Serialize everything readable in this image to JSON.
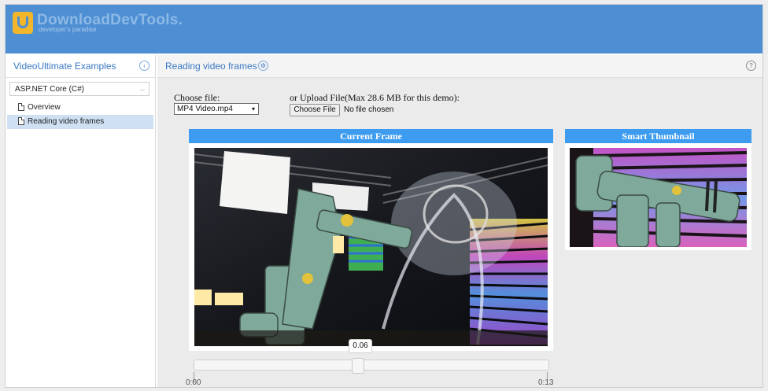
{
  "brand": {
    "title": "DownloadDevTools.",
    "subtitle": "developer's paradise"
  },
  "sidebar": {
    "title": "VideoUltimate Examples",
    "collapse_icon": "chevron-left-circle-icon",
    "platform_select": "ASP.NET Core (C#)",
    "items": [
      {
        "label": "Overview",
        "active": false,
        "icon": "page-icon"
      },
      {
        "label": "Reading video frames",
        "active": true,
        "icon": "page-icon"
      }
    ]
  },
  "main": {
    "title": "Reading video frames",
    "settings_icon": "gear-circle-icon",
    "help_icon": "question-circle-icon",
    "choose_file_label": "Choose file:",
    "file_select_value": "MP4 Video.mp4",
    "upload_label": "or Upload File(Max 28.6 MB for this demo):",
    "choose_button": "Choose File",
    "no_file_text": "No file chosen",
    "current_frame_header": "Current Frame",
    "smart_thumbnail_header": "Smart Thumbnail",
    "slider": {
      "current_time": "0.06",
      "min_label": "0:00",
      "max_label": "0:13",
      "position_fraction": 0.46
    }
  },
  "colors": {
    "header_bar": "#4e8fd3",
    "panel_header": "#3d9bf0",
    "link_blue": "#3a79c3",
    "active_nav": "#cfe0f3"
  }
}
